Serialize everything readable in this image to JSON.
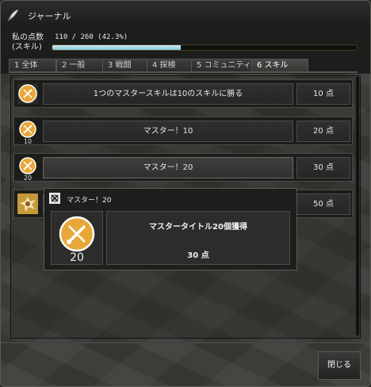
{
  "window": {
    "title": "ジャーナル",
    "icon": "quill-icon"
  },
  "points": {
    "label_line1": "私の点数",
    "label_line2": "(スキル)",
    "value_text": "110 / 260 (42.3%)",
    "progress": 0.423
  },
  "tabs": [
    {
      "label": "1 全体"
    },
    {
      "label": "2 一般"
    },
    {
      "label": "3 戦闘"
    },
    {
      "label": "4 探検"
    },
    {
      "label": "5 コミュニティ"
    },
    {
      "label": "6 スキル"
    }
  ],
  "rows": [
    {
      "text": "1つのマスタースキルは10のスキルに勝る",
      "points": "10 点",
      "level": ""
    },
    {
      "text": "マスター！10",
      "points": "20 点",
      "level": "10"
    },
    {
      "text": "マスター！20",
      "points": "30 点",
      "level": "20"
    },
    {
      "text": "",
      "points": "50 点",
      "level": ""
    }
  ],
  "tooltip": {
    "heading": "マスター！20",
    "level": "20",
    "title": "マスタータイトル20個獲得",
    "points": "30 点"
  },
  "buttons": {
    "close": "閉じる"
  },
  "colors": {
    "badge": "#e8a838",
    "progress": "#a8dbe6"
  }
}
